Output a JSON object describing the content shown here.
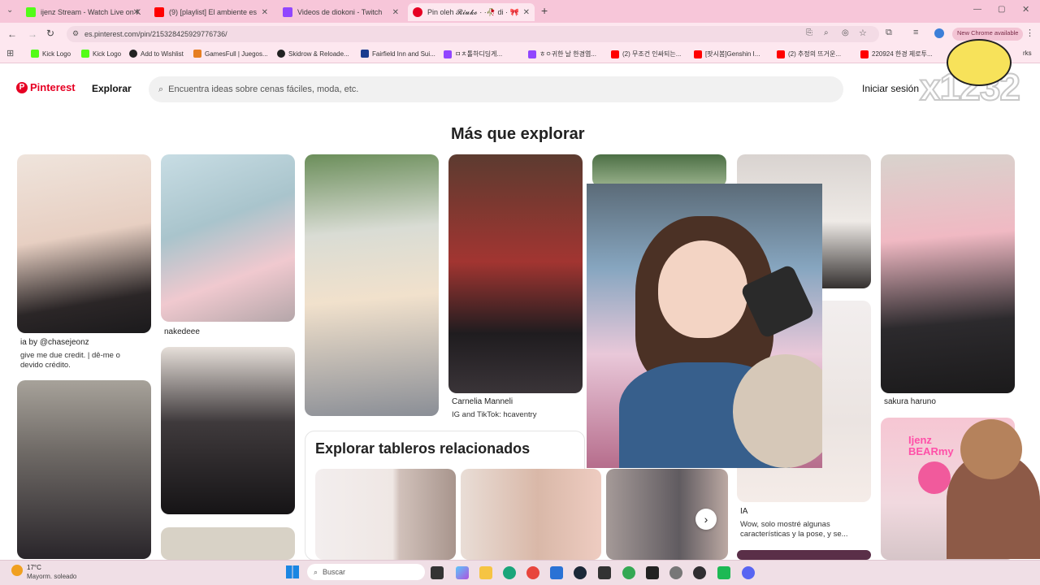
{
  "browser": {
    "tabs": [
      {
        "title": "ijenz Stream - Watch Live on K",
        "color": "#53fc18"
      },
      {
        "title": "(9) [playlist] El ambiente es",
        "color": "#ff0000"
      },
      {
        "title": "Videos de diokoni - Twitch",
        "color": "#9146ff"
      },
      {
        "title": "Pin oleh 𝓡𝓲𝓾𝓴𝓸 · ·🥀 di · 🎀",
        "color": "#e60023"
      }
    ],
    "new_tab": "+",
    "url": "es.pinterest.com/pin/215328425929776736/",
    "chrome_badge": "New Chrome available",
    "bookmarks": [
      {
        "label": "Kick Logo",
        "color": "#53fc18"
      },
      {
        "label": "Kick Logo",
        "color": "#53fc18"
      },
      {
        "label": "Add to Wishlist",
        "color": "#222222"
      },
      {
        "label": "GamesFull | Juegos...",
        "color": "#e67e22"
      },
      {
        "label": "Skidrow & Reloade...",
        "color": "#222222"
      },
      {
        "label": "Fairfield Inn and Sui...",
        "color": "#1a3c8f"
      },
      {
        "label": "ㅁㅊ톨하디딩게...",
        "color": "#9146ff"
      },
      {
        "label": "ㅎㅇ귀한 날 한경엽...",
        "color": "#9146ff"
      },
      {
        "label": "(2) 무조건 인싸되는...",
        "color": "#ff0000"
      },
      {
        "label": "[팟시봄]Genshin I...",
        "color": "#ff0000"
      },
      {
        "label": "(2) 추정의 뜨거운...",
        "color": "#ff0000"
      },
      {
        "label": "220924 한경 제로투...",
        "color": "#ff0000"
      }
    ],
    "bookmarks_more": "rks"
  },
  "pinterest": {
    "logo": "Pinterest",
    "explore": "Explorar",
    "search_placeholder": "Encuentra ideas sobre cenas fáciles, moda, etc.",
    "login": "Iniciar sesión",
    "section_title": "Más que explorar",
    "boards_title": "Explorar tableros relacionados",
    "captions": {
      "c1_line1": "ia by @chasejeonz",
      "c1_line2": "give me due credit. | dê-me o",
      "c1_line3": "devido crédito.",
      "c2": "nakedeee",
      "c4_title": "Carnelia Manneli",
      "c4_sub": "IG and TikTok: hcaventry",
      "c6_title": "IA",
      "c6_line1": "Wow, solo mostré algunas",
      "c6_line2": "características y la pose, y se...",
      "c7": "sakura haruno"
    }
  },
  "overlay": {
    "watermark": "x1232",
    "sticker_text": "Ijenz\nBEARmy"
  },
  "taskbar": {
    "weather_temp": "17°C",
    "weather_desc": "Mayorm. soleado",
    "search": "Buscar"
  }
}
